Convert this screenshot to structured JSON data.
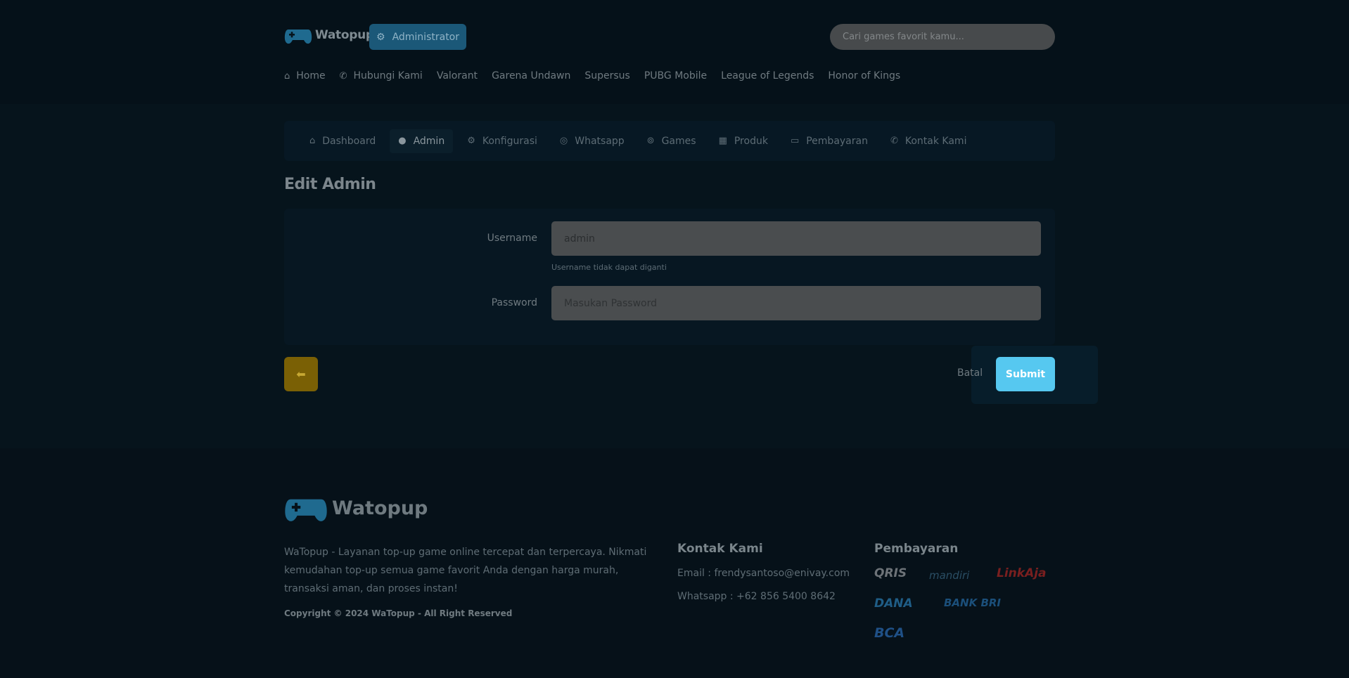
{
  "header": {
    "logo_text": "Watopup",
    "badge_label": "Administrator",
    "search_placeholder": "Cari games favorit kamu...",
    "nav": [
      {
        "label": "Home",
        "icon": "home-icon"
      },
      {
        "label": "Hubungi Kami",
        "icon": "phone-icon"
      },
      {
        "label": "Valorant"
      },
      {
        "label": "Garena Undawn"
      },
      {
        "label": "Supersus"
      },
      {
        "label": "PUBG Mobile"
      },
      {
        "label": "League of Legends"
      },
      {
        "label": "Honor of Kings"
      }
    ]
  },
  "admin_tabs": [
    {
      "label": "Dashboard",
      "icon": "home-icon"
    },
    {
      "label": "Admin",
      "icon": "user-icon",
      "active": true
    },
    {
      "label": "Konfigurasi",
      "icon": "gear-icon"
    },
    {
      "label": "Whatsapp",
      "icon": "whatsapp-icon"
    },
    {
      "label": "Games",
      "icon": "gamepad-icon"
    },
    {
      "label": "Produk",
      "icon": "calendar-icon"
    },
    {
      "label": "Pembayaran",
      "icon": "credit-card-icon"
    },
    {
      "label": "Kontak Kami",
      "icon": "phone-icon"
    }
  ],
  "page_title": "Edit Admin",
  "form": {
    "username_label": "Username",
    "username_value": "admin",
    "username_hint": "Username tidak dapat diganti",
    "password_label": "Password",
    "password_placeholder": "Masukan Password",
    "cancel_label": "Batal",
    "submit_label": "Submit"
  },
  "footer": {
    "logo_text": "Watopup",
    "description": "WaTopup - Layanan top-up game online tercepat dan terpercaya. Nikmati kemudahan top-up semua game favorit Anda dengan harga murah, transaksi aman, dan proses instan!",
    "copyright": "Copyright © 2024 WaTopup - All Right Reserved",
    "contact_heading": "Kontak Kami",
    "email": "Email : frendysantoso@enivay.com",
    "whatsapp": "Whatsapp : +62 856 5400 8642",
    "payment_heading": "Pembayaran",
    "payments": [
      "QRIS",
      "mandiri",
      "LinkAja",
      "DANA",
      "BANK BRI",
      "BCA"
    ]
  },
  "colors": {
    "accent": "#56c8f0",
    "badge": "#1b5878",
    "back_button": "#7a6005",
    "background": "#06141c"
  }
}
